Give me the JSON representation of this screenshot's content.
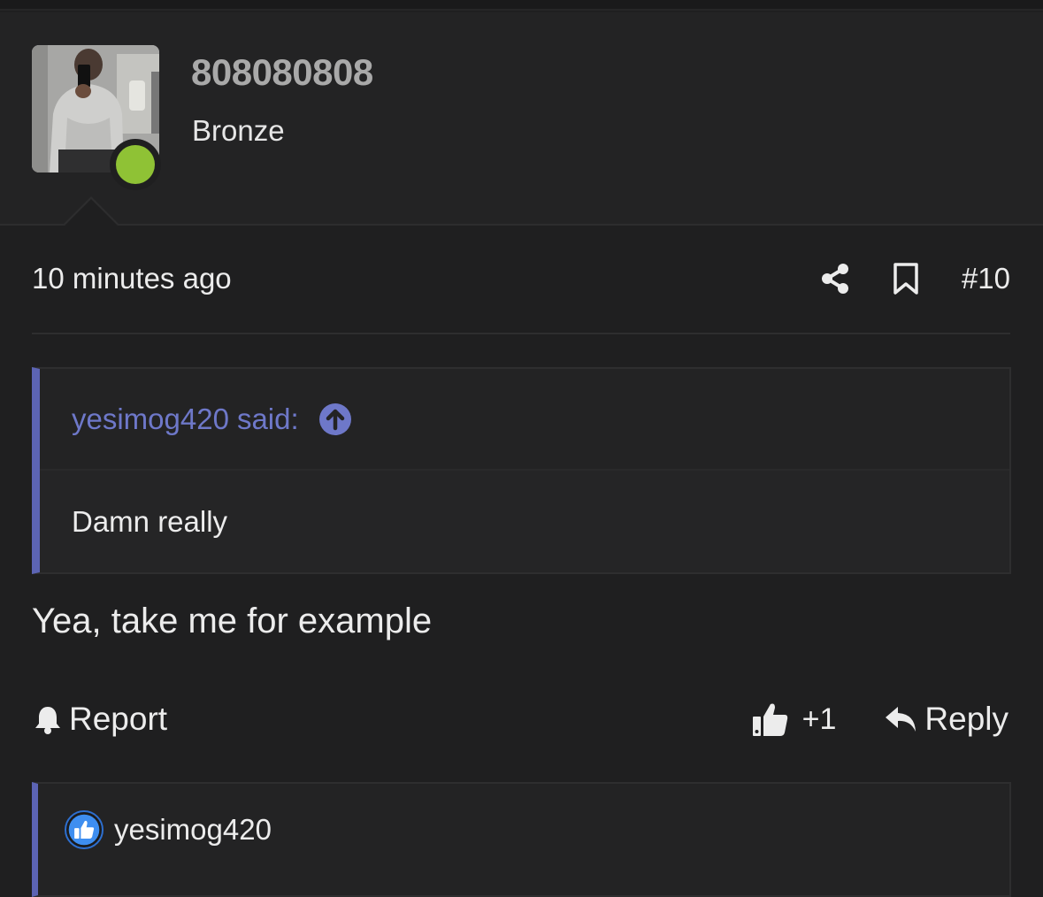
{
  "user": {
    "username": "808080808",
    "rank": "Bronze",
    "status_color": "#8fc235"
  },
  "post": {
    "timestamp": "10 minutes ago",
    "post_number": "#10",
    "text": "Yea, take me for example"
  },
  "quote": {
    "author": "yesimog420",
    "said": "said:",
    "body": "Damn really",
    "accent_color": "#5c64b4"
  },
  "actions": {
    "report_label": "Report",
    "like_count": "+1",
    "reply_label": "Reply"
  },
  "reactions": {
    "user": "yesimog420",
    "icon": "thumbs-up-icon"
  },
  "icons": {
    "share": "share-icon",
    "bookmark": "bookmark-icon",
    "jump": "arrow-up-circle-icon",
    "bell": "bell-icon",
    "like": "thumbs-up-icon",
    "reply": "reply-icon"
  }
}
